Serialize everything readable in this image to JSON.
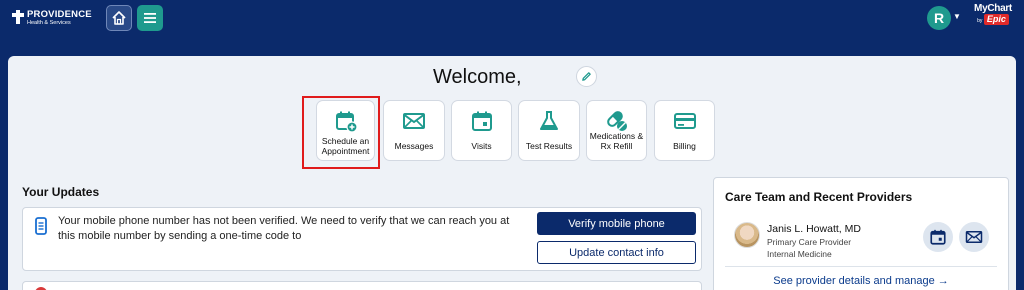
{
  "header": {
    "logo_name": "PROVIDENCE",
    "logo_sub": "Health & Services",
    "avatar_initial": "R",
    "brand_top": "MyChart",
    "brand_by": "by",
    "brand_epic": "Epic",
    "accent": "#1f9a8e",
    "nav_bg": "#0b2a6b"
  },
  "welcome": {
    "title": "Welcome,"
  },
  "tiles": [
    {
      "label": "Schedule an Appointment",
      "icon": "calendar-plus-icon"
    },
    {
      "label": "Messages",
      "icon": "envelope-icon"
    },
    {
      "label": "Visits",
      "icon": "calendar-icon"
    },
    {
      "label": "Test Results",
      "icon": "flask-icon"
    },
    {
      "label": "Medications & Rx Refill",
      "icon": "pill-icon"
    },
    {
      "label": "Billing",
      "icon": "credit-card-icon"
    }
  ],
  "updates": {
    "title": "Your Updates",
    "message": "Your mobile phone number has not been verified. We need to verify that we can reach you at this mobile number by sending a one-time code to",
    "verify_label": "Verify mobile phone",
    "update_label": "Update contact info"
  },
  "care_team": {
    "title": "Care Team and Recent Providers",
    "provider_name": "Janis L. Howatt, MD",
    "provider_role": "Primary Care Provider",
    "provider_dept": "Internal Medicine",
    "link": "See provider details and manage →"
  }
}
